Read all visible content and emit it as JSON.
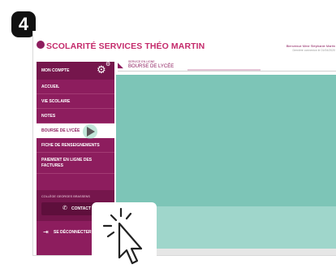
{
  "step_badge": "4",
  "header": {
    "title": "SCOLARITÉ SERVICES",
    "user_name": "THÉO MARTIN",
    "greeting": "Bienvenue Mme Stéphanie Martin",
    "last_login": "Dernière connexion le 01/04/2020"
  },
  "sidebar": {
    "account_label": "MON COMPTE",
    "items": [
      {
        "label": "ACCUEIL"
      },
      {
        "label": "VIE SCOLAIRE"
      },
      {
        "label": "NOTES"
      },
      {
        "label": "BOURSE DE LYCÉE"
      },
      {
        "label": "FICHE DE RENSEIGNEMENTS"
      },
      {
        "label": "PAIEMENT EN LIGNE DES FACTURES"
      }
    ],
    "school_name": "COLLÈGE GEORGES BRASSENS",
    "contact_label": "CONTACT",
    "logout_label": "SE DÉCONNECTER"
  },
  "breadcrumb": {
    "service": "SERVICE EN LIGNE",
    "title": "BOURSE DE LYCÉE"
  },
  "colors": {
    "brand": "#8d1d5e",
    "accent": "#c42a6b",
    "content": "#7dc5b7"
  },
  "icons": [
    "gear-icon",
    "phone-icon",
    "logout-icon",
    "pointer-cursor-icon",
    "click-burst-icon"
  ]
}
